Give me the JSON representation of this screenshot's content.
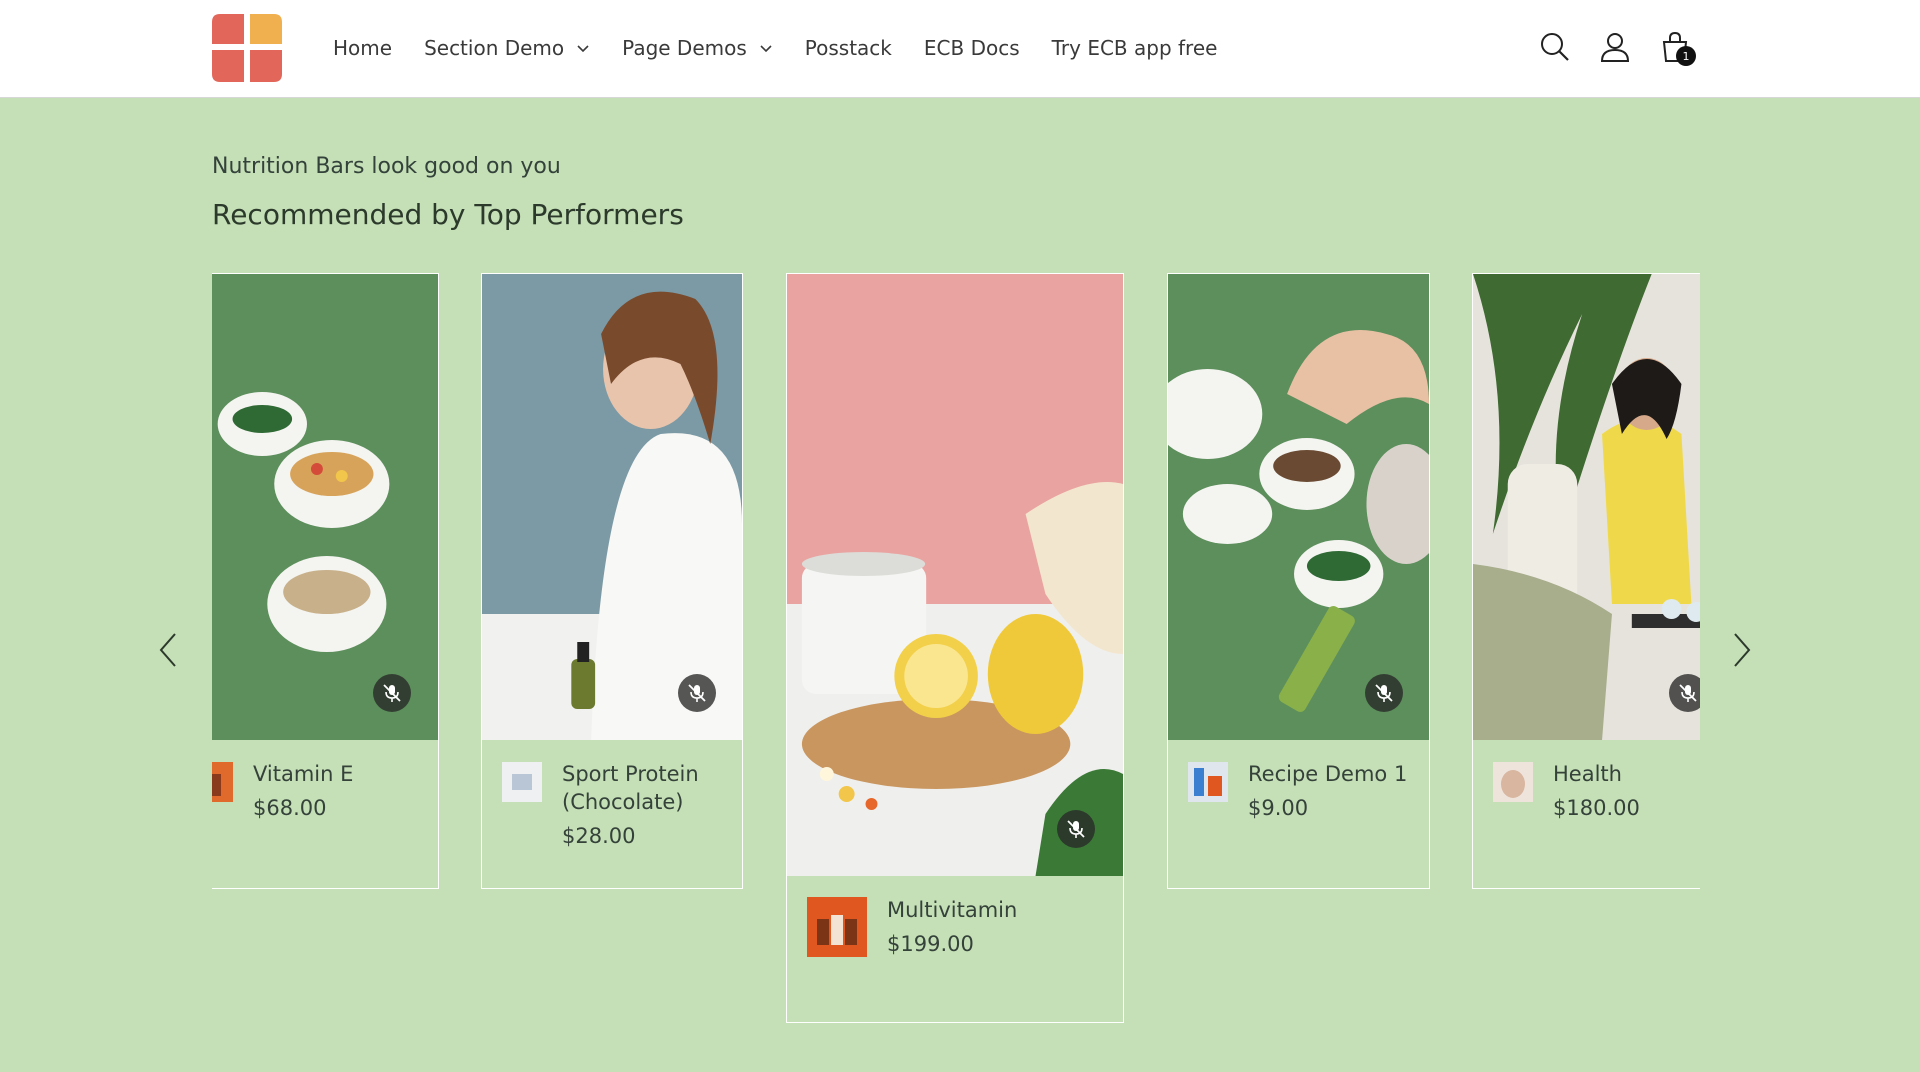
{
  "header": {
    "nav": [
      {
        "label": "Home",
        "dropdown": false
      },
      {
        "label": "Section Demo",
        "dropdown": true
      },
      {
        "label": "Page Demos",
        "dropdown": true
      },
      {
        "label": "Posstack",
        "dropdown": false
      },
      {
        "label": "ECB Docs",
        "dropdown": false
      },
      {
        "label": "Try ECB app free",
        "dropdown": false
      }
    ],
    "cart_count": "1",
    "icons": [
      "search-icon",
      "account-icon",
      "cart-icon"
    ]
  },
  "section": {
    "subtitle": "Nutrition Bars look good on you",
    "title": "Recommended by Top Performers"
  },
  "products": [
    {
      "name": "Vitamin E",
      "price": "$68.00"
    },
    {
      "name": "Sport Protein (Chocolate)",
      "price": "$28.00"
    },
    {
      "name": "Multivitamin",
      "price": "$199.00"
    },
    {
      "name": "Recipe Demo 1",
      "price": "$9.00"
    },
    {
      "name": "Health",
      "price": "$180.00"
    }
  ],
  "colors": {
    "background": "#c5dfb6",
    "header": "#ffffff",
    "logo_red": "#e3665a",
    "logo_orange": "#f0b04f"
  }
}
